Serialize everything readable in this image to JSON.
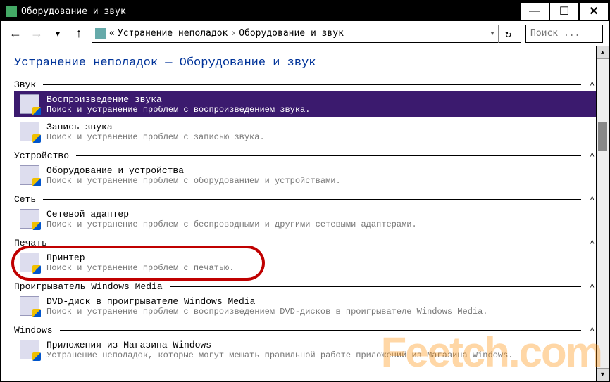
{
  "window": {
    "title": "Оборудование и звук",
    "buttons": {
      "min": "—",
      "max": "☐",
      "close": "✕"
    }
  },
  "nav": {
    "back": "←",
    "forward": "→",
    "up": "↑",
    "breadcrumb_prefix": "«",
    "crumb1": "Устранение неполадок",
    "crumb2": "Оборудование и звук",
    "sep": "›",
    "refresh": "↻",
    "search_placeholder": "Поиск ..."
  },
  "page": {
    "title": "Устранение неполадок — Оборудование и звук"
  },
  "groups": [
    {
      "label": "Звук",
      "items": [
        {
          "name": "audio-playback",
          "title": "Воспроизведение звука",
          "desc": "Поиск и устранение проблем с воспроизведением звука.",
          "selected": true
        },
        {
          "name": "audio-record",
          "title": "Запись звука",
          "desc": "Поиск и устранение проблем с записью звука."
        }
      ]
    },
    {
      "label": "Устройство",
      "items": [
        {
          "name": "hardware-devices",
          "title": "Оборудование и устройства",
          "desc": "Поиск и устранение проблем с оборудованием и устройствами."
        }
      ]
    },
    {
      "label": "Сеть",
      "items": [
        {
          "name": "network-adapter",
          "title": "Сетевой адаптер",
          "desc": "Поиск и устранение проблем с беспроводными и другими сетевыми адаптерами."
        }
      ]
    },
    {
      "label": "Печать",
      "items": [
        {
          "name": "printer",
          "title": "Принтер",
          "desc": "Поиск и устранение проблем с печатью.",
          "highlighted": true
        }
      ]
    },
    {
      "label": "Проигрыватель Windows Media",
      "items": [
        {
          "name": "wmp-dvd",
          "title": "DVD-диск в проигрывателе Windows Media",
          "desc": "Поиск и устранение проблем с воспроизведением DVD-дисков в проигрывателе Windows Media."
        }
      ]
    },
    {
      "label": "Windows",
      "items": [
        {
          "name": "store-apps",
          "title": "Приложения из Магазина Windows",
          "desc": "Устранение неполадок, которые могут мешать правильной работе приложений из Магазина Windows."
        }
      ]
    }
  ],
  "watermark": "Feetch.com",
  "chevron": "˄"
}
